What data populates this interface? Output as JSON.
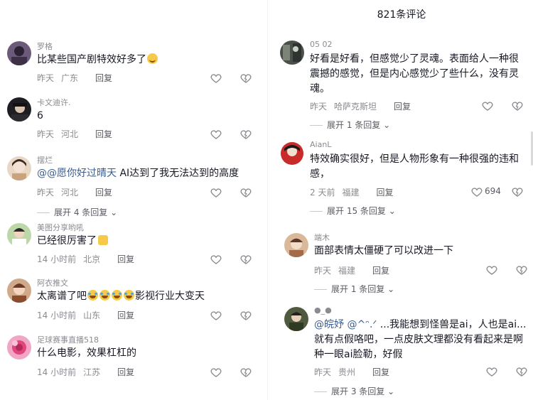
{
  "header": {
    "title": "821条评论"
  },
  "left": {
    "comments": [
      {
        "username": "罗格",
        "text": "比某些国产剧特效好多了",
        "time": "昨天",
        "location": "广东",
        "reply": "回复"
      },
      {
        "username": "卡文迪许.",
        "text": "6",
        "time": "昨天",
        "location": "河北",
        "reply": "回复"
      },
      {
        "username": "摆烂",
        "mention": "@@愿你好过晴天",
        "text": " AI达到了我无法达到的高度",
        "time": "昨天",
        "location": "河北",
        "reply": "回复",
        "expand": "展开 4 条回复"
      },
      {
        "username": "美图分享哟吼",
        "text": "已经很厉害了",
        "time": "14 小时前",
        "location": "北京",
        "reply": "回复"
      },
      {
        "username": "阿衣推文",
        "text_a": "太离谱了吧",
        "text_b": "影视行业大变天",
        "time": "14 小时前",
        "location": "山东",
        "reply": "回复"
      },
      {
        "username": "足球赛事直播518",
        "text": "什么电影，效果杠杠的",
        "time": "14 小时前",
        "location": "江苏",
        "reply": "回复"
      }
    ]
  },
  "right": {
    "comments": [
      {
        "username": "05     02",
        "text": "好看是好看，但感觉少了灵魂。表面给人一种很震撼的感觉，但是内心感觉少了些什么，没有灵魂。",
        "time": "昨天",
        "location": "哈萨克斯坦",
        "reply": "回复",
        "expand": "展开 1 条回复"
      },
      {
        "username": "AianL",
        "text": "特效确实很好，但是人物形象有一种很强的违和感，",
        "time": "2 天前",
        "location": "福建",
        "reply": "回复",
        "likes": "694",
        "expand": "展开 15 条回复"
      },
      {
        "username": "端木",
        "text": "面部表情太僵硬了可以改进一下",
        "time": "昨天",
        "location": "福建",
        "reply": "回复",
        "expand": "展开 1 条回复"
      },
      {
        "username": "●_●",
        "mention": "@皖妤 @^ᵔ.ᐟ",
        "text": " ...我能想到怪兽是ai，人也是ai...就有点假咯吧，一点皮肤文理都没有看起来是啊种一眼ai脸勒，好假",
        "time": "昨天",
        "location": "贵州",
        "reply": "回复",
        "expand": "展开 3 条回复"
      }
    ]
  }
}
